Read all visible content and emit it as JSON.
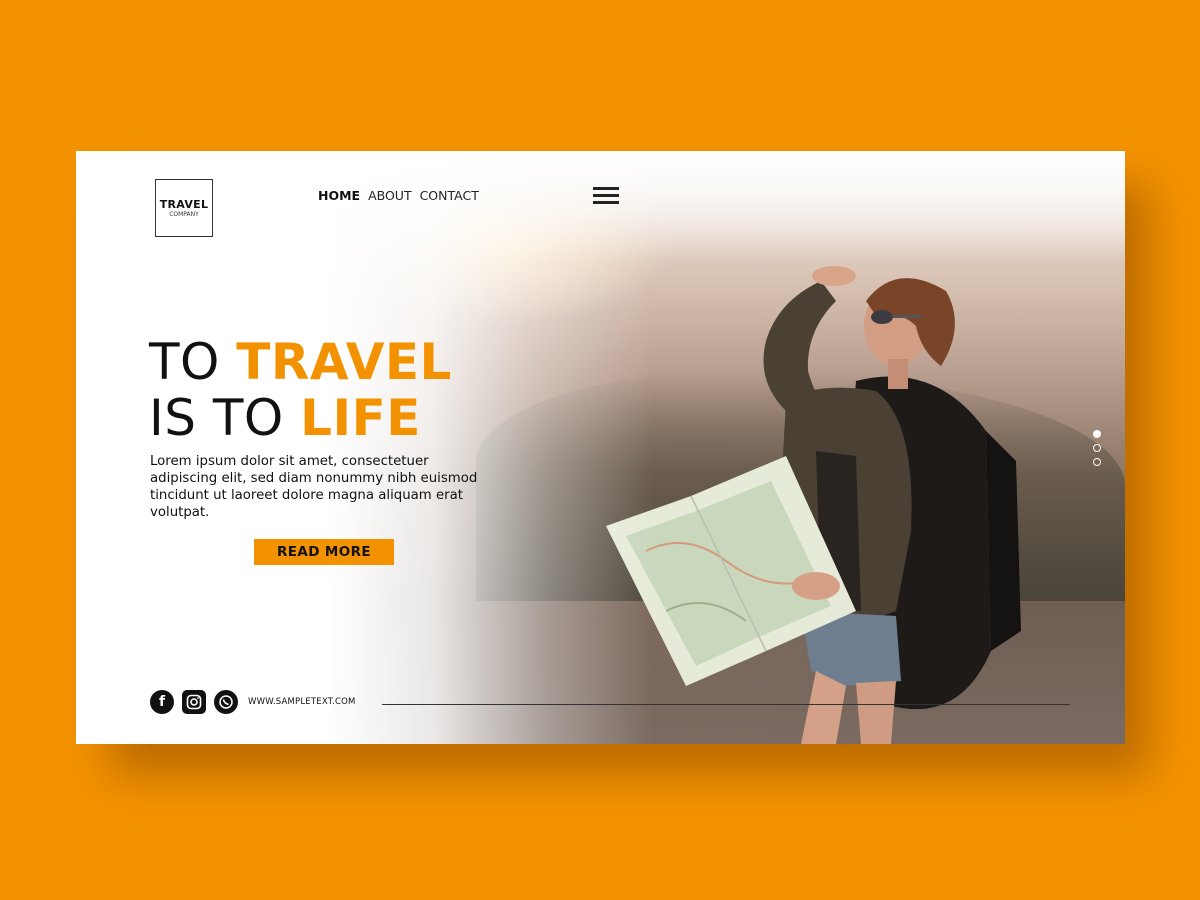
{
  "brand": {
    "title": "TRAVEL",
    "subtitle": "COMPANY"
  },
  "nav": {
    "items": [
      {
        "label": "HOME",
        "active": true
      },
      {
        "label": "ABOUT",
        "active": false
      },
      {
        "label": "CONTACT",
        "active": false
      }
    ],
    "menu_icon": "hamburger-menu-icon"
  },
  "hero": {
    "line1_prefix": "TO ",
    "line1_accent": "TRAVEL",
    "line2_prefix": "IS TO ",
    "line2_accent": "LIFE",
    "body": "Lorem ipsum dolor sit amet, consectetuer adipiscing elit, sed diam nonummy nibh euismod tincidunt ut laoreet dolore magna aliquam erat volutpat.",
    "cta_label": "READ MORE"
  },
  "slider": {
    "dots": 3,
    "active_index": 0
  },
  "footer": {
    "social_icons": [
      "facebook-icon",
      "instagram-icon",
      "whatsapp-icon"
    ],
    "url": "WWW.SAMPLETEXT.COM"
  },
  "colors": {
    "background": "#F39200",
    "accent": "#F39200",
    "text": "#111111",
    "card": "#FFFFFF"
  }
}
